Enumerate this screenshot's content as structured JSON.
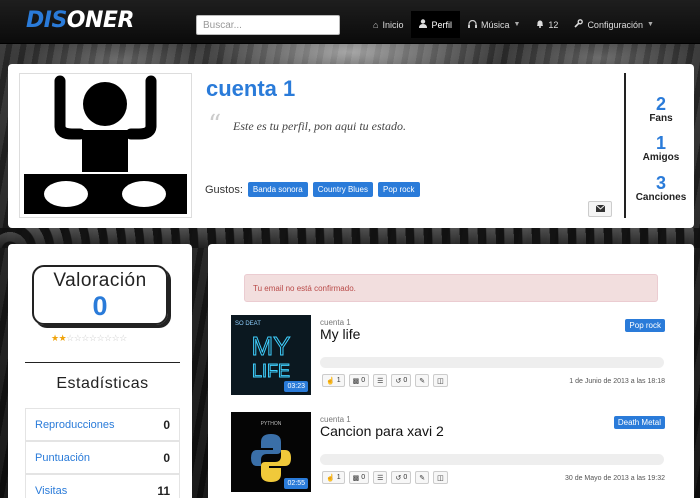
{
  "nav": {
    "logo_part1": "DIS",
    "logo_part2": "ONER",
    "search_placeholder": "Buscar...",
    "items": [
      {
        "label": "Inicio",
        "icon": "home-icon",
        "glyph": "⌂",
        "active": false,
        "dropdown": false
      },
      {
        "label": "Perfil",
        "icon": "user-icon",
        "glyph": "☺",
        "active": true,
        "dropdown": false
      },
      {
        "label": "Música",
        "icon": "headphones-icon",
        "glyph": "◠",
        "active": false,
        "dropdown": true
      },
      {
        "label": "12",
        "icon": "bell-icon",
        "glyph": "⍾",
        "active": false,
        "dropdown": false
      },
      {
        "label": "Configuración",
        "icon": "wrench-icon",
        "glyph": "⚒",
        "active": false,
        "dropdown": true
      }
    ]
  },
  "profile": {
    "name": "cuenta 1",
    "status": "Este es tu perfil, pon aqui tu estado.",
    "gustos_label": "Gustos:",
    "gustos": [
      "Banda sonora",
      "Country Blues",
      "Pop rock"
    ],
    "stats": [
      {
        "value": "2",
        "label": "Fans"
      },
      {
        "value": "1",
        "label": "Amigos"
      },
      {
        "value": "3",
        "label": "Canciones"
      }
    ]
  },
  "sidebar": {
    "valoracion_label": "Valoración",
    "valoracion_value": "0",
    "stars_filled": 2,
    "stars_total": 10,
    "stats_title": "Estadísticas",
    "stats": [
      {
        "label": "Reproducciones",
        "value": "0"
      },
      {
        "label": "Puntuación",
        "value": "0"
      },
      {
        "label": "Visitas",
        "value": "11"
      }
    ]
  },
  "main": {
    "alert": "Tu email no está confirmado.",
    "songs": [
      {
        "user": "cuenta 1",
        "title": "My life",
        "genre": "Pop rock",
        "duration": "03:23",
        "likes": "1",
        "comments": "0",
        "reposts": "0",
        "date": "1 de Junio de 2013 a las 18:18",
        "cover_top": "SO DEAT",
        "cover_main": "MY",
        "cover_main2": "LIFE"
      },
      {
        "user": "cuenta 1",
        "title": "Cancion para xavi 2",
        "genre": "Death Metal",
        "duration": "02:55",
        "likes": "1",
        "comments": "0",
        "reposts": "0",
        "date": "30 de Mayo de 2013 a las 19:32",
        "cover_top": "PYTHON"
      }
    ]
  }
}
